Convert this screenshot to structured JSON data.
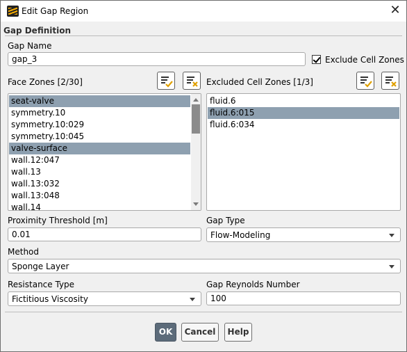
{
  "window": {
    "title": "Edit Gap Region",
    "icon": "fluent-app-icon",
    "close_icon": "close-icon"
  },
  "section": {
    "title": "Gap Definition"
  },
  "gap_name": {
    "label": "Gap Name",
    "value": "gap_3"
  },
  "exclude_cell_zones": {
    "label": "Exclude Cell Zones",
    "checked": true
  },
  "face_zones": {
    "label": "Face Zones [2/30]",
    "items": [
      {
        "label": "seat-valve",
        "selected": true
      },
      {
        "label": "symmetry.10",
        "selected": false
      },
      {
        "label": "symmetry.10:029",
        "selected": false
      },
      {
        "label": "symmetry.10:045",
        "selected": false
      },
      {
        "label": "valve-surface",
        "selected": true
      },
      {
        "label": "wall.12:047",
        "selected": false
      },
      {
        "label": "wall.13",
        "selected": false
      },
      {
        "label": "wall.13:032",
        "selected": false
      },
      {
        "label": "wall.13:048",
        "selected": false
      },
      {
        "label": "wall.14",
        "selected": false
      }
    ],
    "select_all_icon": "select-all-icon",
    "deselect_all_icon": "deselect-all-icon"
  },
  "excluded_cell_zones": {
    "label": "Excluded Cell Zones [1/3]",
    "items": [
      {
        "label": "fluid.6",
        "selected": false
      },
      {
        "label": "fluid.6:015",
        "selected": true
      },
      {
        "label": "fluid.6:034",
        "selected": false
      }
    ],
    "select_all_icon": "select-all-icon",
    "deselect_all_icon": "deselect-all-icon"
  },
  "proximity_threshold": {
    "label": "Proximity Threshold [m]",
    "value": "0.01"
  },
  "gap_type": {
    "label": "Gap Type",
    "value": "Flow-Modeling"
  },
  "method": {
    "label": "Method",
    "value": "Sponge Layer"
  },
  "resistance_type": {
    "label": "Resistance Type",
    "value": "Fictitious Viscosity"
  },
  "gap_reynolds": {
    "label": "Gap Reynolds Number",
    "value": "100"
  },
  "buttons": {
    "ok": "OK",
    "cancel": "Cancel",
    "help": "Help"
  },
  "colors": {
    "selection": "#8ea0b0",
    "primary_button": "#5c6b7a",
    "check_accent": "#e0a000"
  }
}
